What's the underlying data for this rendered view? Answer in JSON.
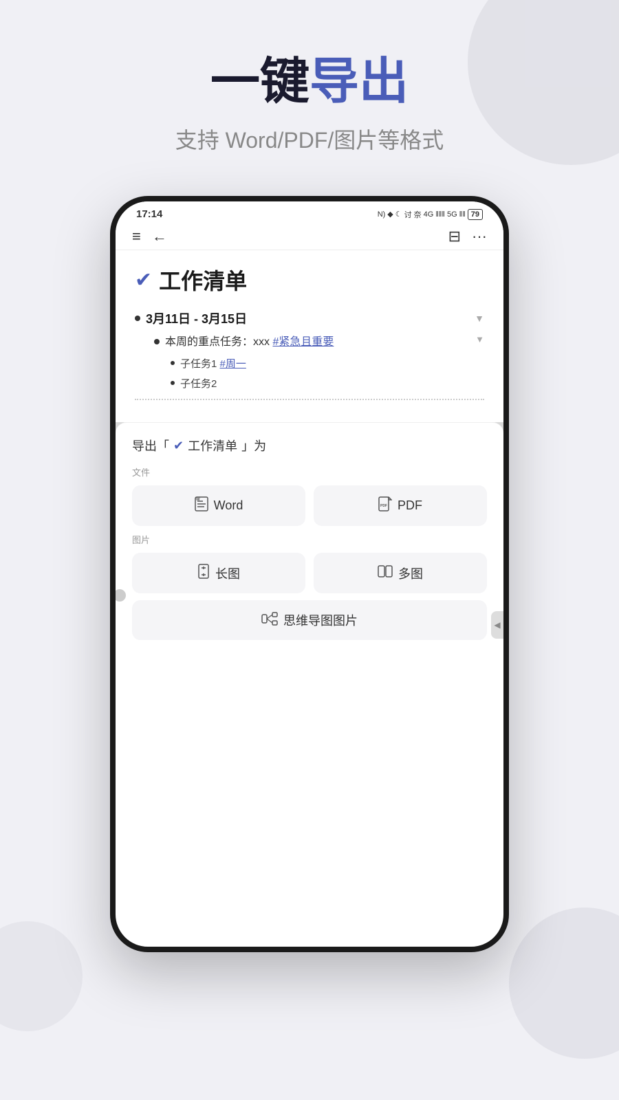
{
  "header": {
    "title_part1": "一键",
    "title_part2": "导出",
    "subtitle": "支持 Word/PDF/图片等格式"
  },
  "statusBar": {
    "time": "17:14",
    "icons": "N) ♦ ☾ 讨 奈 46 56 79"
  },
  "toolbar": {
    "menuIcon": "≡",
    "backIcon": "←",
    "outlineIcon": "⊟",
    "moreIcon": "···"
  },
  "note": {
    "checkIcon": "✔",
    "title": "工作清单",
    "dateRange": "3月11日 - 3月15日",
    "mainTask": "本周的重点任务：xxx",
    "mainTaskTag": "#紧急且重要",
    "subTask1": "子任务1",
    "subTask1Tag": "#周一",
    "subTask2": "子任务2"
  },
  "exportDialog": {
    "prefix": "导出「",
    "checkIcon": "✔",
    "noteName": "工作清单",
    "suffix": "」为",
    "sectionFile": "文件",
    "sectionImage": "图片",
    "buttons": {
      "word": "Word",
      "pdf": "PDF",
      "longImage": "长图",
      "multiImage": "多图",
      "mindMap": "思维导图图片"
    },
    "wordIcon": "⊡",
    "pdfIcon": "⊡",
    "longImageIcon": "⧖",
    "multiImageIcon": "▯",
    "mindMapIcon": "▯"
  }
}
